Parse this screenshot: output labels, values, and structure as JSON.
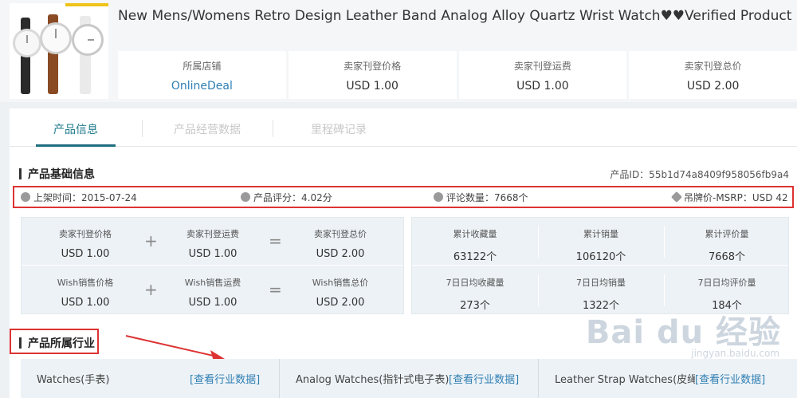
{
  "product": {
    "title": "New Mens/Womens Retro Design Leather Band Analog Alloy Quartz Wrist Watch♥♥Verified Product"
  },
  "header_stats": [
    {
      "label": "所属店铺",
      "value": "OnlineDeal"
    },
    {
      "label": "卖家刊登价格",
      "value": "USD 1.00"
    },
    {
      "label": "卖家刊登运费",
      "value": "USD 1.00"
    },
    {
      "label": "卖家刊登总价",
      "value": "USD 2.00"
    }
  ],
  "tabs": [
    "产品信息",
    "产品经营数据",
    "里程碑记录"
  ],
  "basic_info": {
    "title": "产品基础信息",
    "product_id": "产品ID：55b1d74a8409f958056fb9a4",
    "listed": "上架时间：2015-07-24",
    "rating": "产品评分：4.02分",
    "reviews": "评论数量：7668个",
    "msrp": "吊牌价-MSRP：USD 42"
  },
  "seller_prices": {
    "price_label": "卖家刊登价格",
    "price_value": "USD 1.00",
    "shipping_label": "卖家刊登运费",
    "shipping_value": "USD 1.00",
    "total_label": "卖家刊登总价",
    "total_value": "USD 2.00"
  },
  "wish_prices": {
    "price_label": "Wish销售价格",
    "price_value": "USD 1.00",
    "shipping_label": "Wish销售运费",
    "shipping_value": "USD 1.00",
    "total_label": "Wish销售总价",
    "total_value": "USD 2.00"
  },
  "totals": {
    "fav_label": "累计收藏量",
    "fav_value": "63122个",
    "sales_label": "累计销量",
    "sales_value": "106120个",
    "reviews_label": "累计评价量",
    "reviews_value": "7668个"
  },
  "daily": {
    "fav_label": "7日日均收藏量",
    "fav_value": "273个",
    "sales_label": "7日日均销量",
    "sales_value": "1322个",
    "reviews_label": "7日日均评价量",
    "reviews_value": "184个"
  },
  "operators": {
    "plus": "+",
    "equals": "="
  },
  "industry": {
    "title": "产品所属行业",
    "link_label": "[查看行业数据]",
    "items": [
      "Watches(手表)",
      "Analog Watches(指针式电子表)",
      "Leather Strap Watches(皮绳手表)"
    ]
  },
  "watermark": {
    "text": "Bai du 经验",
    "sub": "jingyan.baidu.com"
  },
  "colors": {
    "accent": "#1f6e80",
    "link": "#2f7fb3",
    "highlight": "#dd3333"
  }
}
